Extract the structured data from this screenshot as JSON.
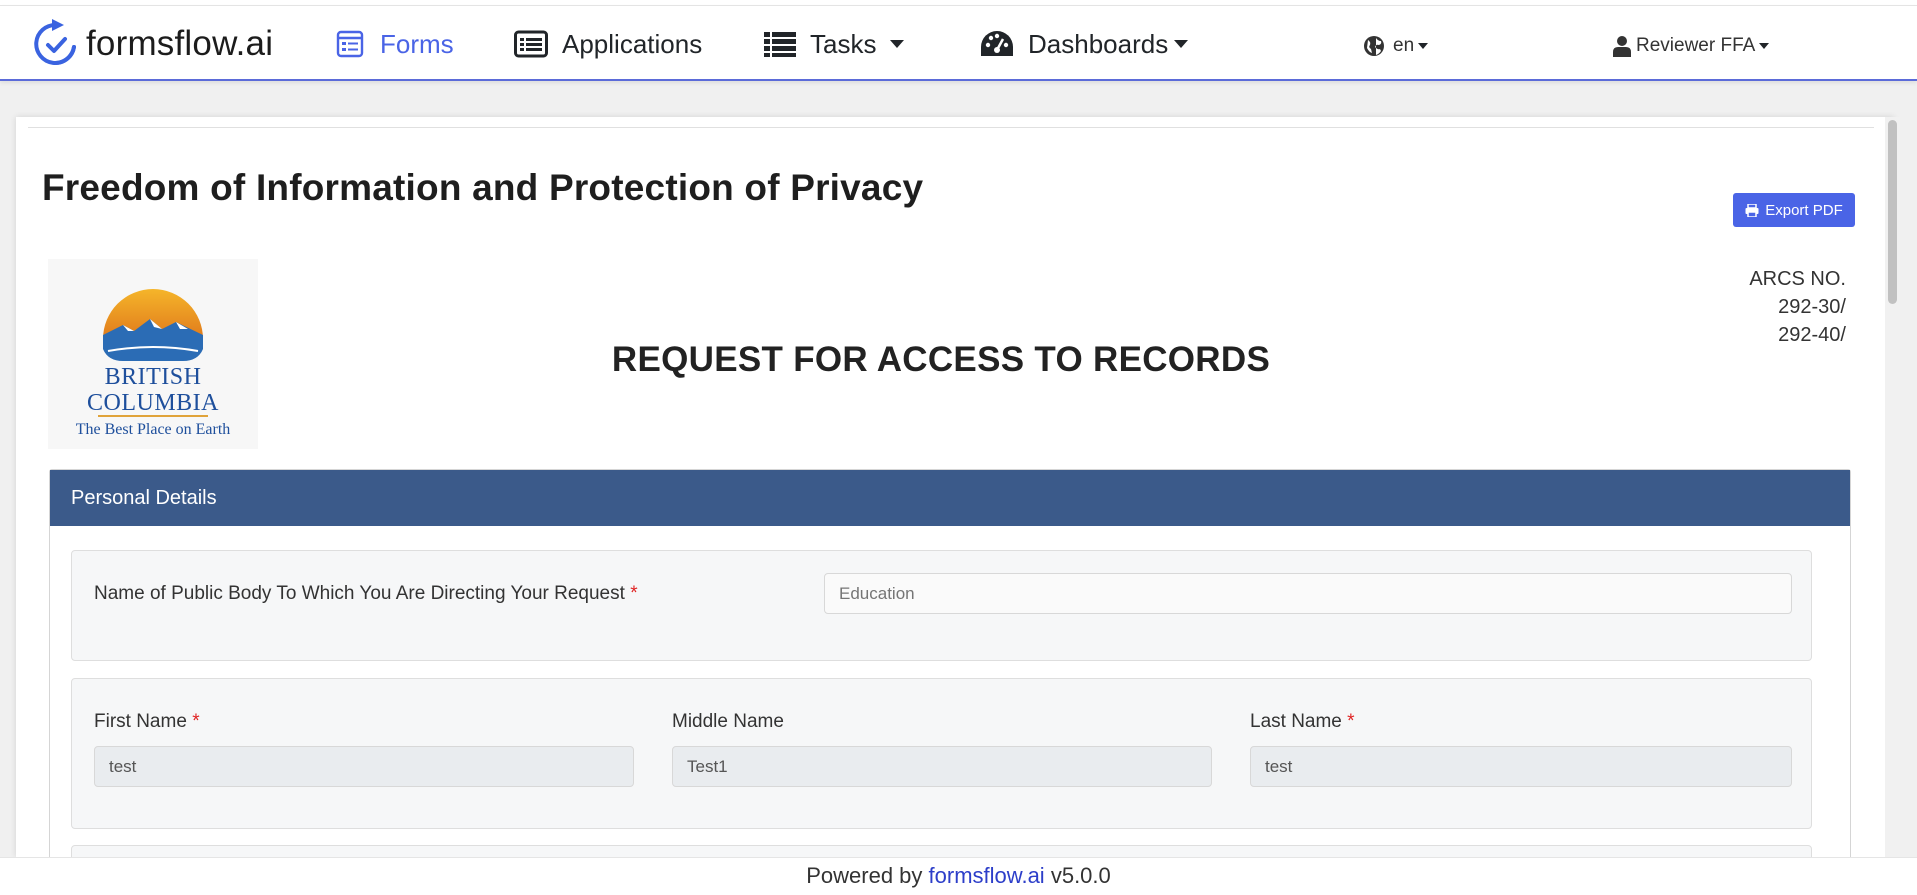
{
  "app": {
    "brand": "formsflow.ai",
    "version": "v5.0.0"
  },
  "nav": {
    "forms": "Forms",
    "applications": "Applications",
    "tasks": "Tasks",
    "dashboards": "Dashboards",
    "language": "en",
    "user": "Reviewer FFA"
  },
  "page": {
    "title": "Freedom of Information and Protection of Privacy",
    "export_label": "Export PDF"
  },
  "logo": {
    "line1": "BRITISH",
    "line2": "COLUMBIA",
    "tagline": "The Best Place on Earth"
  },
  "arcs": {
    "label": "ARCS NO.",
    "line1": "292-30/",
    "line2": "292-40/"
  },
  "form": {
    "title": "REQUEST FOR ACCESS TO RECORDS",
    "panel_title": "Personal Details",
    "public_body_label": "Name of Public Body To Which You Are Directing Your Request",
    "public_body_value": "Education",
    "first_name_label": "First Name",
    "first_name_value": "test",
    "middle_name_label": "Middle Name",
    "middle_name_value": "Test1",
    "last_name_label": "Last Name",
    "last_name_value": "test",
    "required_mark": "*"
  },
  "footer": {
    "prefix": "Powered by",
    "link": "formsflow.ai",
    "version": "v5.0.0"
  },
  "colors": {
    "accent": "#4a64e6",
    "panel_header": "#3b5a8a",
    "required": "#e02424"
  }
}
